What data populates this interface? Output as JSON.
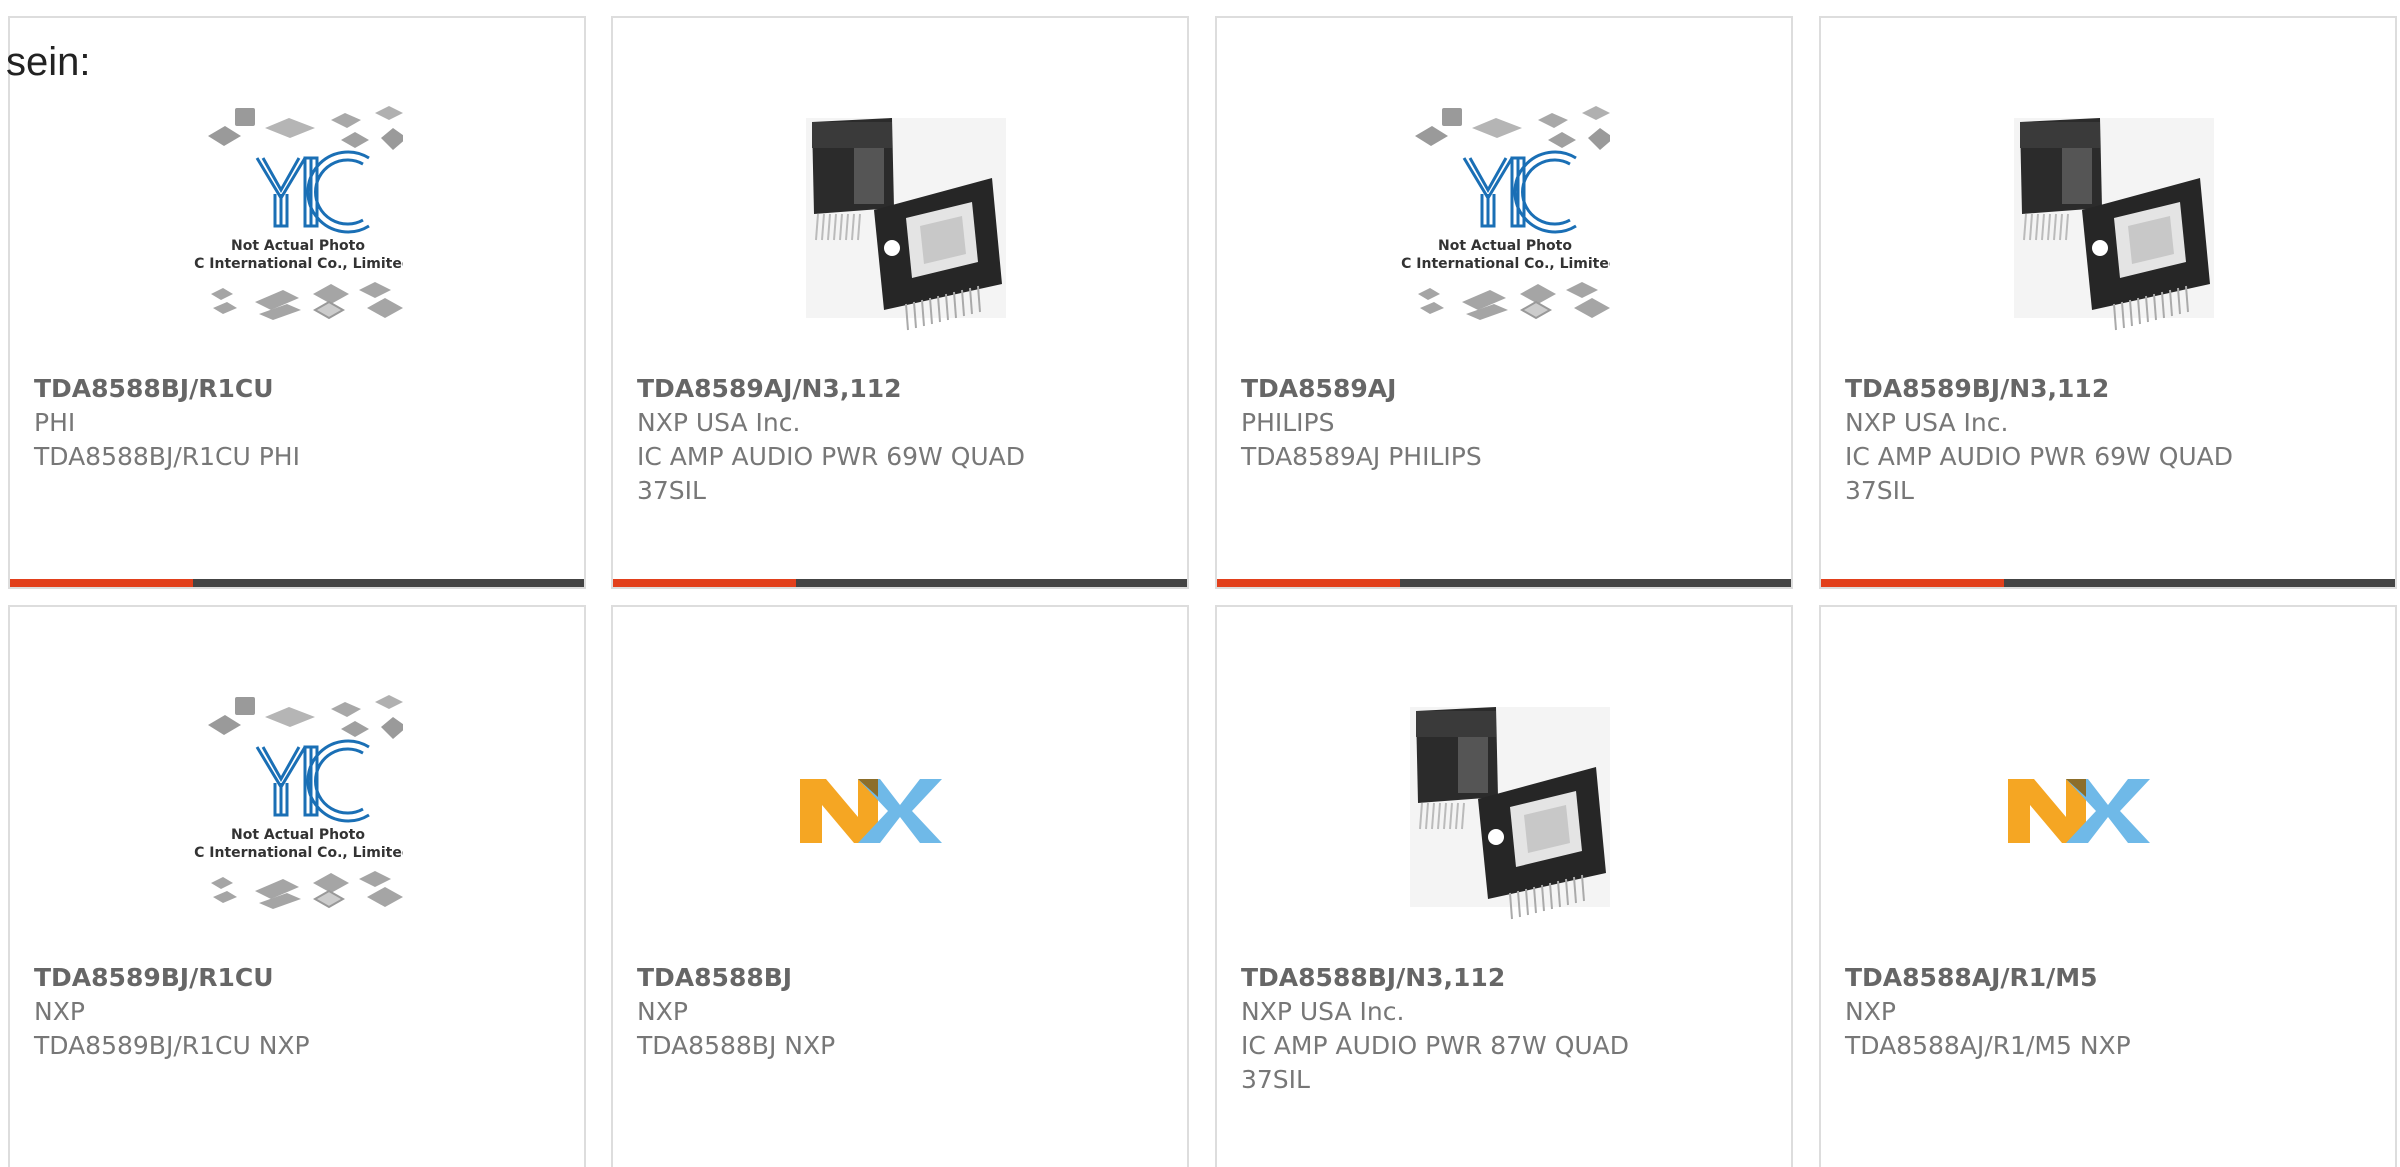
{
  "lead_text": "sein:",
  "colors": {
    "accent": "#e2401c",
    "bar": "#444444",
    "yic_blue": "#1a6fb5",
    "nxp_yellow": "#f5a623",
    "nxp_blue": "#6fb9e8",
    "nxp_green": "#b8d433"
  },
  "cards": [
    {
      "part": "TDA8588BJ/R1CU",
      "manufacturer": "PHI",
      "description": "TDA8588BJ/R1CU PHI",
      "image": "yic-placeholder-image",
      "caption_line1": "Not Actual Photo",
      "caption_line2": "YIC International Co., Limited."
    },
    {
      "part": "TDA8589AJ/N3,112",
      "manufacturer": "NXP USA Inc.",
      "description": "IC AMP AUDIO PWR 69W QUAD 37SIL",
      "image": "chip-photo-image"
    },
    {
      "part": "TDA8589AJ",
      "manufacturer": "PHILIPS",
      "description": "TDA8589AJ PHILIPS",
      "image": "yic-placeholder-image",
      "caption_line1": "Not Actual Photo",
      "caption_line2": "YIC International Co., Limited."
    },
    {
      "part": "TDA8589BJ/N3,112",
      "manufacturer": "NXP USA Inc.",
      "description": "IC AMP AUDIO PWR 69W QUAD 37SIL",
      "image": "chip-photo-image"
    },
    {
      "part": "TDA8589BJ/R1CU",
      "manufacturer": "NXP",
      "description": "TDA8589BJ/R1CU NXP",
      "image": "yic-placeholder-image",
      "caption_line1": "Not Actual Photo",
      "caption_line2": "YIC International Co., Limited."
    },
    {
      "part": "TDA8588BJ",
      "manufacturer": "NXP",
      "description": "TDA8588BJ NXP",
      "image": "nxp-logo-image"
    },
    {
      "part": "TDA8588BJ/N3,112",
      "manufacturer": "NXP USA Inc.",
      "description": "IC AMP AUDIO PWR 87W QUAD 37SIL",
      "image": "chip-photo-image"
    },
    {
      "part": "TDA8588AJ/R1/M5",
      "manufacturer": "NXP",
      "description": "TDA8588AJ/R1/M5 NXP",
      "image": "nxp-logo-image"
    }
  ]
}
